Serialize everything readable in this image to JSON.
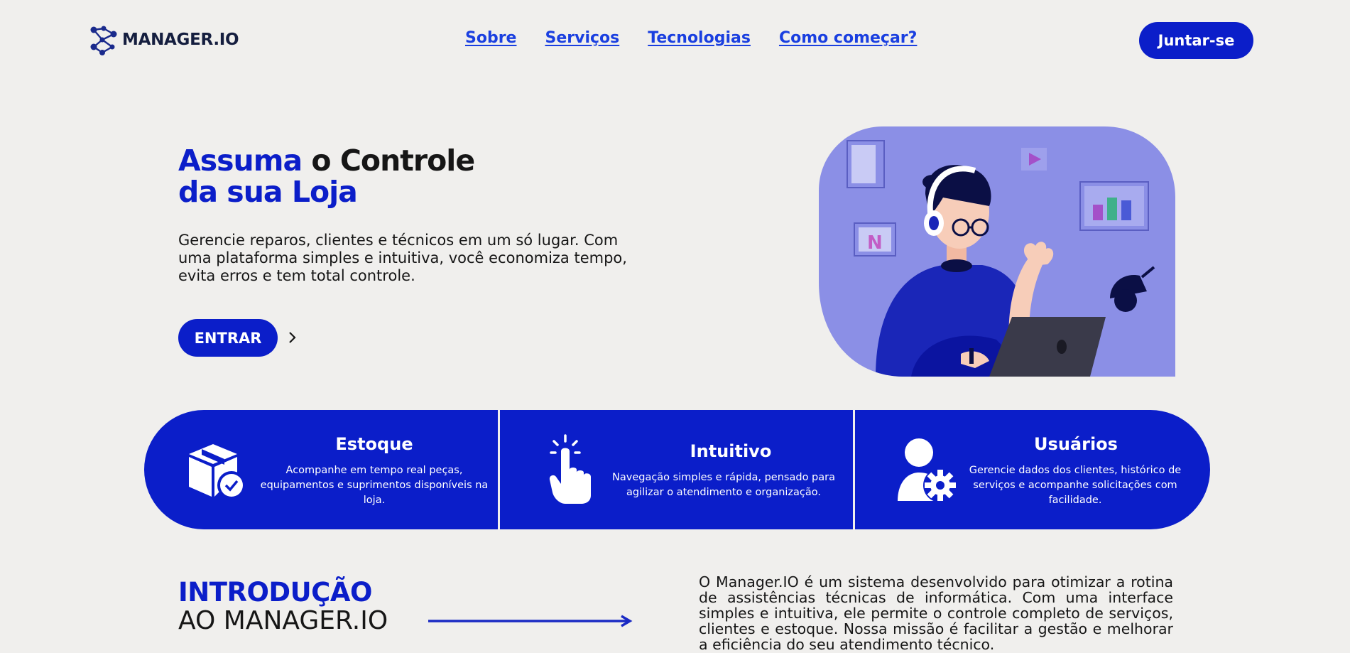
{
  "header": {
    "logo_text": "MANAGER.IO",
    "nav": [
      "Sobre",
      "Serviços",
      "Tecnologias",
      "Como começar?"
    ],
    "join_label": "Juntar-se"
  },
  "hero": {
    "title_part1": "Assuma",
    "title_part2": " o ",
    "title_part3": "Controle",
    "title_line2": "da sua Loja",
    "description": "Gerencie reparos, clientes e técnicos em um só lugar. Com uma plataforma simples e intuitiva, você economiza tempo, evita erros e tem total controle.",
    "cta_label": "ENTRAR"
  },
  "features": [
    {
      "title": "Estoque",
      "text": "Acompanhe em tempo real peças, equipamentos e suprimentos disponíveis na loja.",
      "icon": "box-check-icon"
    },
    {
      "title": "Intuitivo",
      "text": "Navegação simples e rápida, pensado para agilizar o atendimento e organização.",
      "icon": "hand-pointer-icon"
    },
    {
      "title": "Usuários",
      "text": "Gerencie dados dos clientes, histórico de serviços e acompanhe solicitações com facilidade.",
      "icon": "user-gear-icon"
    }
  ],
  "intro": {
    "title_line1": "INTRODUÇÃO",
    "title_line2": "AO MANAGER.IO",
    "text": "O Manager.IO é um sistema desenvolvido para otimizar a rotina de assistências técnicas de informática. Com uma interface simples e intuitiva, ele permite o controle completo de serviços, clientes e estoque. Nossa missão é facilitar a gestão e melhorar a eficiência do seu atendimento técnico."
  },
  "colors": {
    "primary": "#0b1ec9",
    "link": "#1a3fe0",
    "background": "#f0efed",
    "illustration_bg": "#8b8fe6"
  }
}
